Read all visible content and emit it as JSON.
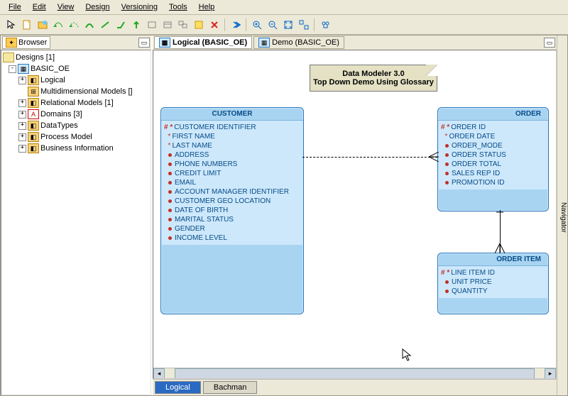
{
  "menu": {
    "file": "File",
    "edit": "Edit",
    "view": "View",
    "design": "Design",
    "versioning": "Versioning",
    "tools": "Tools",
    "help": "Help"
  },
  "browser": {
    "title": "Browser",
    "root": "Designs [1]",
    "design": "BASIC_OE",
    "nodes": {
      "logical": "Logical",
      "mdm": "Multidimensional Models []",
      "rel": "Relational Models [1]",
      "domains": "Domains [3]",
      "datatypes": "DataTypes",
      "process": "Process Model",
      "bi": "Business Information"
    }
  },
  "doc_tabs": {
    "logical": "Logical (BASIC_OE)",
    "demo": "Demo (BASIC_OE)"
  },
  "note": {
    "line1": "Data Modeler 3.0",
    "line2": "Top Down Demo Using Glossary"
  },
  "entities": {
    "customer": {
      "title": "CUSTOMER",
      "attrs": [
        {
          "m": "#*",
          "n": "CUSTOMER IDENTIFIER"
        },
        {
          "m": "*",
          "n": "FIRST NAME"
        },
        {
          "m": "*",
          "n": "LAST NAME"
        },
        {
          "m": "o",
          "n": "ADDRESS"
        },
        {
          "m": "o",
          "n": "PHONE NUMBERS"
        },
        {
          "m": "o",
          "n": "CREDIT LIMIT"
        },
        {
          "m": "o",
          "n": "EMAIL"
        },
        {
          "m": "o",
          "n": "ACCOUNT MANAGER IDENTIFIER"
        },
        {
          "m": "o",
          "n": "CUSTOMER GEO LOCATION"
        },
        {
          "m": "o",
          "n": "DATE OF BIRTH"
        },
        {
          "m": "o",
          "n": "MARITAL STATUS"
        },
        {
          "m": "o",
          "n": "GENDER"
        },
        {
          "m": "o",
          "n": "INCOME LEVEL"
        }
      ]
    },
    "order": {
      "title": "ORDER",
      "attrs": [
        {
          "m": "#*",
          "n": "ORDER ID"
        },
        {
          "m": "*",
          "n": "ORDER DATE"
        },
        {
          "m": "o",
          "n": "ORDER_MODE"
        },
        {
          "m": "o",
          "n": "ORDER STATUS"
        },
        {
          "m": "o",
          "n": "ORDER TOTAL"
        },
        {
          "m": "o",
          "n": "SALES REP ID"
        },
        {
          "m": "o",
          "n": "PROMOTION ID"
        }
      ]
    },
    "order_item": {
      "title": "ORDER ITEM",
      "attrs": [
        {
          "m": "#*",
          "n": "LINE ITEM ID"
        },
        {
          "m": "o",
          "n": "UNIT PRICE"
        },
        {
          "m": "o",
          "n": "QUANTITY"
        }
      ]
    }
  },
  "bottom_tabs": {
    "logical": "Logical",
    "bachman": "Bachman"
  },
  "navigator": "Navigator",
  "colors": {
    "entity_border": "#2a77bb",
    "entity_bg": "#a8d4f1"
  }
}
